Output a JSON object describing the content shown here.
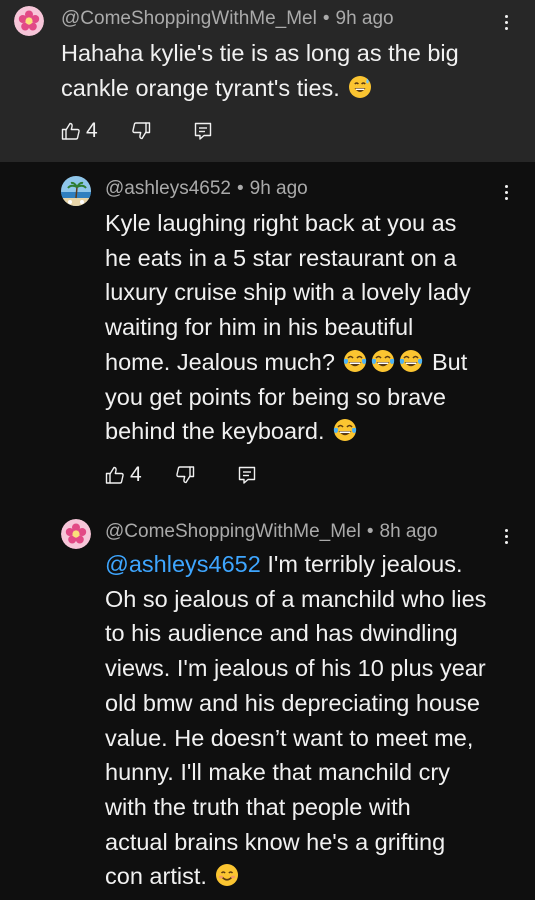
{
  "comments": [
    {
      "author": "@ComeShoppingWithMe_Mel",
      "time": "9h ago",
      "lines": [
        "Hahaha kylie's tie is as long as the big",
        "cankle orange tyrant's ties."
      ],
      "emoji": "grinning-sweat-emoji",
      "likes": "4",
      "avatar_icon": "pink-flower-avatar",
      "highlighted": true
    },
    {
      "author": "@ashleys4652",
      "time": "9h ago",
      "lines": [
        "Kyle laughing right back at you as",
        "he eats in a 5 star restaurant on a",
        "luxury cruise ship with a lovely lady",
        "waiting for him in his beautiful",
        "home. Jealous much?",
        "But",
        "you get points for being so brave",
        "behind the keyboard."
      ],
      "emoji": "tears-of-joy-emoji",
      "likes": "4",
      "avatar_icon": "beach-palm-avatar"
    },
    {
      "author": "@ComeShoppingWithMe_Mel",
      "time": "8h ago",
      "mention": "@ashleys4652",
      "lines": [
        "I'm terribly jealous.",
        "Oh so jealous of a manchild who lies",
        "to his audience and has dwindling",
        "views. I'm jealous of his 10 plus year",
        "old bmw and his depreciating house",
        "value. He doesn’t want to meet me,",
        "hunny. I'll make that manchild cry",
        "with the truth that people with",
        "actual brains know he's a grifting",
        "con artist."
      ],
      "emoji": "smiling-face-emoji",
      "avatar_icon": "pink-flower-avatar"
    }
  ],
  "icons": {
    "like": "thumbs-up-icon",
    "dislike": "thumbs-down-icon",
    "reply": "reply-icon",
    "more": "more-vertical-icon"
  },
  "colors": {
    "background": "#0f0f0f",
    "highlight": "#272727",
    "text": "#f1f1f1",
    "meta": "#aaaaaa",
    "mention": "#3ea6ff"
  }
}
